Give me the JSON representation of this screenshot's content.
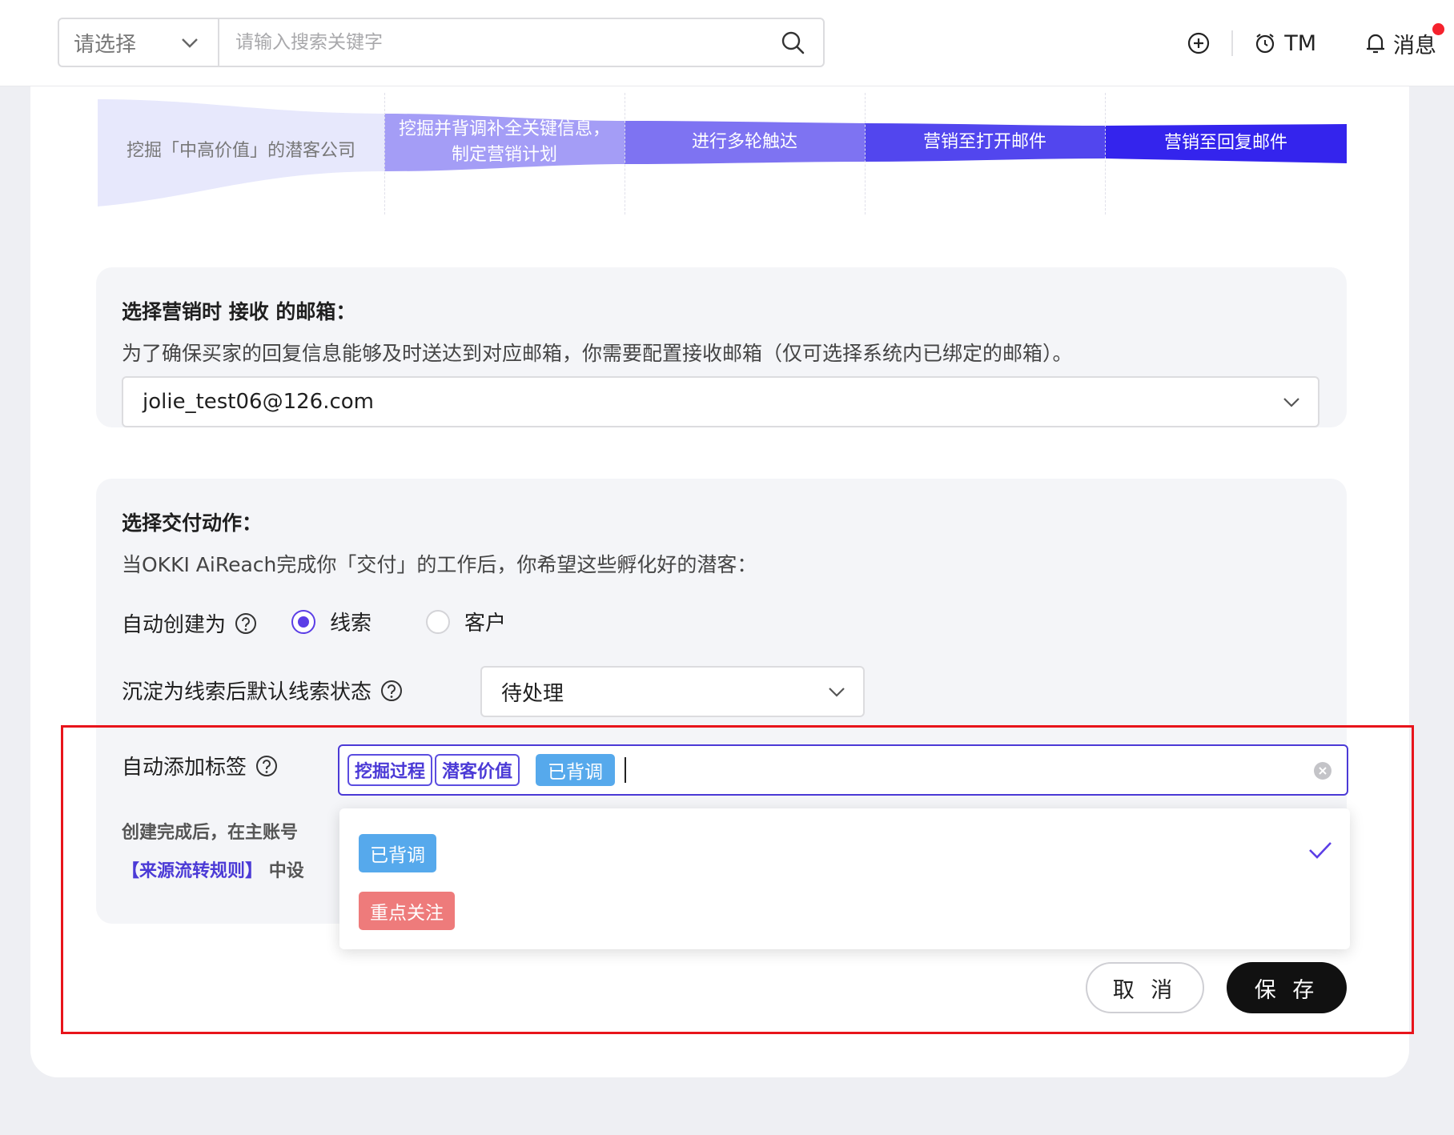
{
  "header": {
    "scope_select": "请选择",
    "search_placeholder": "请输入搜索关键字",
    "user_label": "TM",
    "notifications_label": "消息"
  },
  "funnel": {
    "steps": [
      "挖掘「中高价值」的潜客公司",
      "挖掘并背调补全关键信息，\n制定营销计划",
      "进行多轮触达",
      "营销至打开邮件",
      "营销至回复邮件"
    ],
    "colors": [
      "#e7e8fc",
      "#a49df6",
      "#7e73f2",
      "#5246ee",
      "#3424ed"
    ]
  },
  "email_section": {
    "title": "选择营销时 接收 的邮箱：",
    "description": "为了确保买家的回复信息能够及时送达到对应邮箱，你需要配置接收邮箱（仅可选择系统内已绑定的邮箱）。",
    "selected_email": "jolie_test06@126.com"
  },
  "delivery_section": {
    "title": "选择交付动作：",
    "description": "当OKKI AiReach完成你「交付」的工作后，你希望这些孵化好的潜客：",
    "auto_create_label": "自动创建为",
    "radio_options": [
      {
        "label": "线索",
        "selected": true
      },
      {
        "label": "客户",
        "selected": false
      }
    ],
    "status_label": "沉淀为线索后默认线索状态",
    "status_value": "待处理",
    "tags_label": "自动添加标签",
    "selected_tags_outline": [
      "挖掘过程",
      "潜客价值"
    ],
    "selected_tag_filled": "已背调",
    "note_line1": "创建完成后，在主账号",
    "note_link": "【来源流转规则】",
    "note_line2_suffix": "中设"
  },
  "tag_dropdown": {
    "options": [
      {
        "label": "已背调",
        "color": "#56a9ec",
        "selected": true
      },
      {
        "label": "重点关注",
        "color": "#ee7b7b",
        "selected": false
      }
    ]
  },
  "actions": {
    "cancel_label": "取 消",
    "save_label": "保 存"
  },
  "colors": {
    "accent": "#5b3ee6",
    "highlight_border": "#e8141b"
  }
}
